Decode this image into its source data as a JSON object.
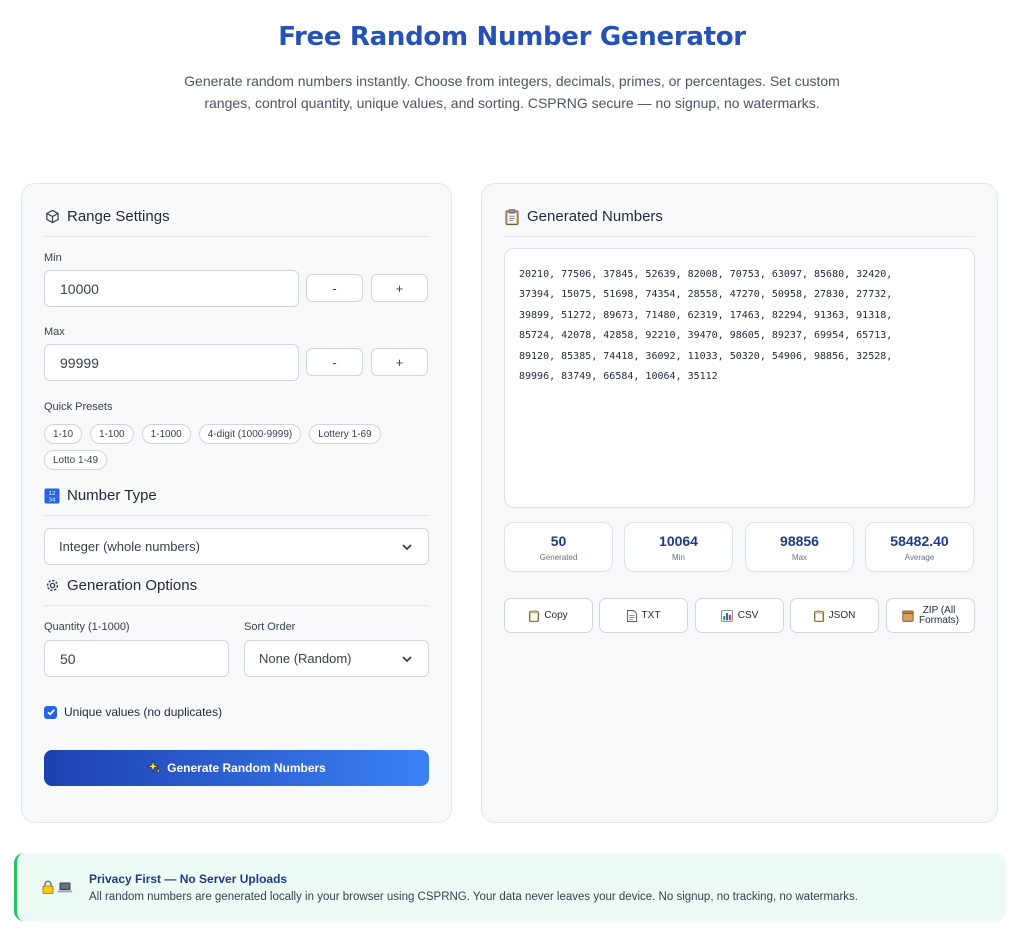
{
  "header": {
    "title": "Free Random Number Generator",
    "description": "Generate random numbers instantly. Choose from integers, decimals, primes, or percentages. Set custom ranges, control quantity, unique values, and sorting. CSPRNG secure — no signup, no watermarks."
  },
  "range": {
    "title": "Range Settings",
    "min_label": "Min",
    "min_value": "10000",
    "max_label": "Max",
    "max_value": "99999",
    "minus": "-",
    "plus": "+",
    "presets_label": "Quick Presets",
    "presets": [
      "1-10",
      "1-100",
      "1-1000",
      "4-digit (1000-9999)",
      "Lottery 1-69",
      "Lotto 1-49"
    ]
  },
  "number_type": {
    "title": "Number Type",
    "selected": "Integer (whole numbers)"
  },
  "options": {
    "title": "Generation Options",
    "quantity_label": "Quantity (1-1000)",
    "quantity_value": "50",
    "sort_label": "Sort Order",
    "sort_selected": "None (Random)",
    "unique_label": "Unique values (no duplicates)",
    "unique_checked": true,
    "generate_label": "Generate Random Numbers"
  },
  "results": {
    "title": "Generated Numbers",
    "numbers": "20210, 77506, 37845, 52639, 82008, 70753, 63097, 85680, 32420,\n37394, 15075, 51698, 74354, 28558, 47270, 50958, 27830, 27732,\n39899, 51272, 89673, 71480, 62319, 17463, 82294, 91363, 91318,\n85724, 42078, 42858, 92210, 39470, 98605, 89237, 69954, 65713,\n89120, 85385, 74418, 36092, 11033, 50320, 54906, 98856, 32528,\n89996, 83749, 66584, 10064, 35112",
    "stats": [
      {
        "value": "50",
        "label": "Generated"
      },
      {
        "value": "10064",
        "label": "Min"
      },
      {
        "value": "98856",
        "label": "Max"
      },
      {
        "value": "58482.40",
        "label": "Average"
      }
    ],
    "downloads": {
      "copy": "Copy",
      "txt": "TXT",
      "csv": "CSV",
      "json": "JSON",
      "zip_line1": "ZIP (All",
      "zip_line2": "Formats)"
    }
  },
  "privacy": {
    "title": "Privacy First — No Server Uploads",
    "text": "All random numbers are generated locally in your browser using CSPRNG. Your data never leaves your device. No signup, no tracking, no watermarks."
  },
  "colors": {
    "accent": "#2452b8",
    "button_gradient_start": "#1e40af",
    "button_gradient_end": "#3b82f6",
    "privacy_bg": "#eefaf4",
    "privacy_border": "#22c55e"
  }
}
